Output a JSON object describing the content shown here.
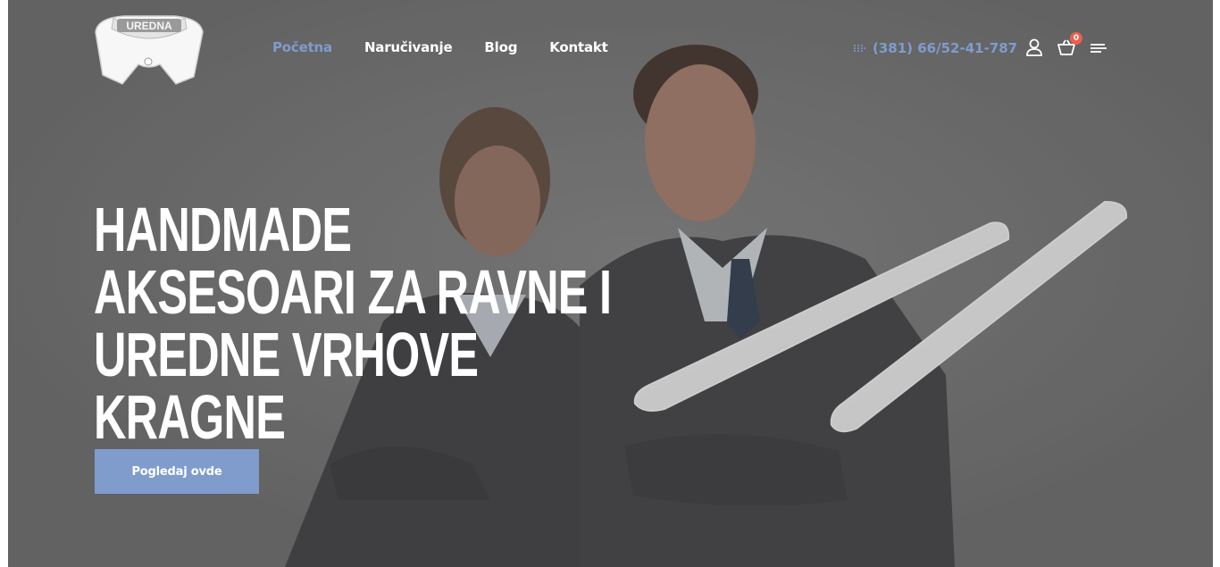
{
  "brand": {
    "logo_text": "UREDNA"
  },
  "nav": {
    "items": [
      {
        "label": "Početna",
        "active": true
      },
      {
        "label": "Naručivanje",
        "active": false
      },
      {
        "label": "Blog",
        "active": false
      },
      {
        "label": "Kontakt",
        "active": false
      }
    ]
  },
  "header": {
    "phone": "(381) 66/52-41-787",
    "cart_count": "0",
    "icons": [
      "dialpad-icon",
      "user-icon",
      "cart-icon",
      "menu-icon"
    ]
  },
  "hero": {
    "headline_lines": [
      "HANDMADE",
      "AKSESOARI ZA RAVNE I",
      "UREDNE VRHOVE",
      "KRAGNE"
    ],
    "cta_label": "Pogledaj ovde"
  },
  "colors": {
    "accent": "#7f9ccc",
    "overlay": "#6b6b6b",
    "badge": "#e8614f"
  }
}
